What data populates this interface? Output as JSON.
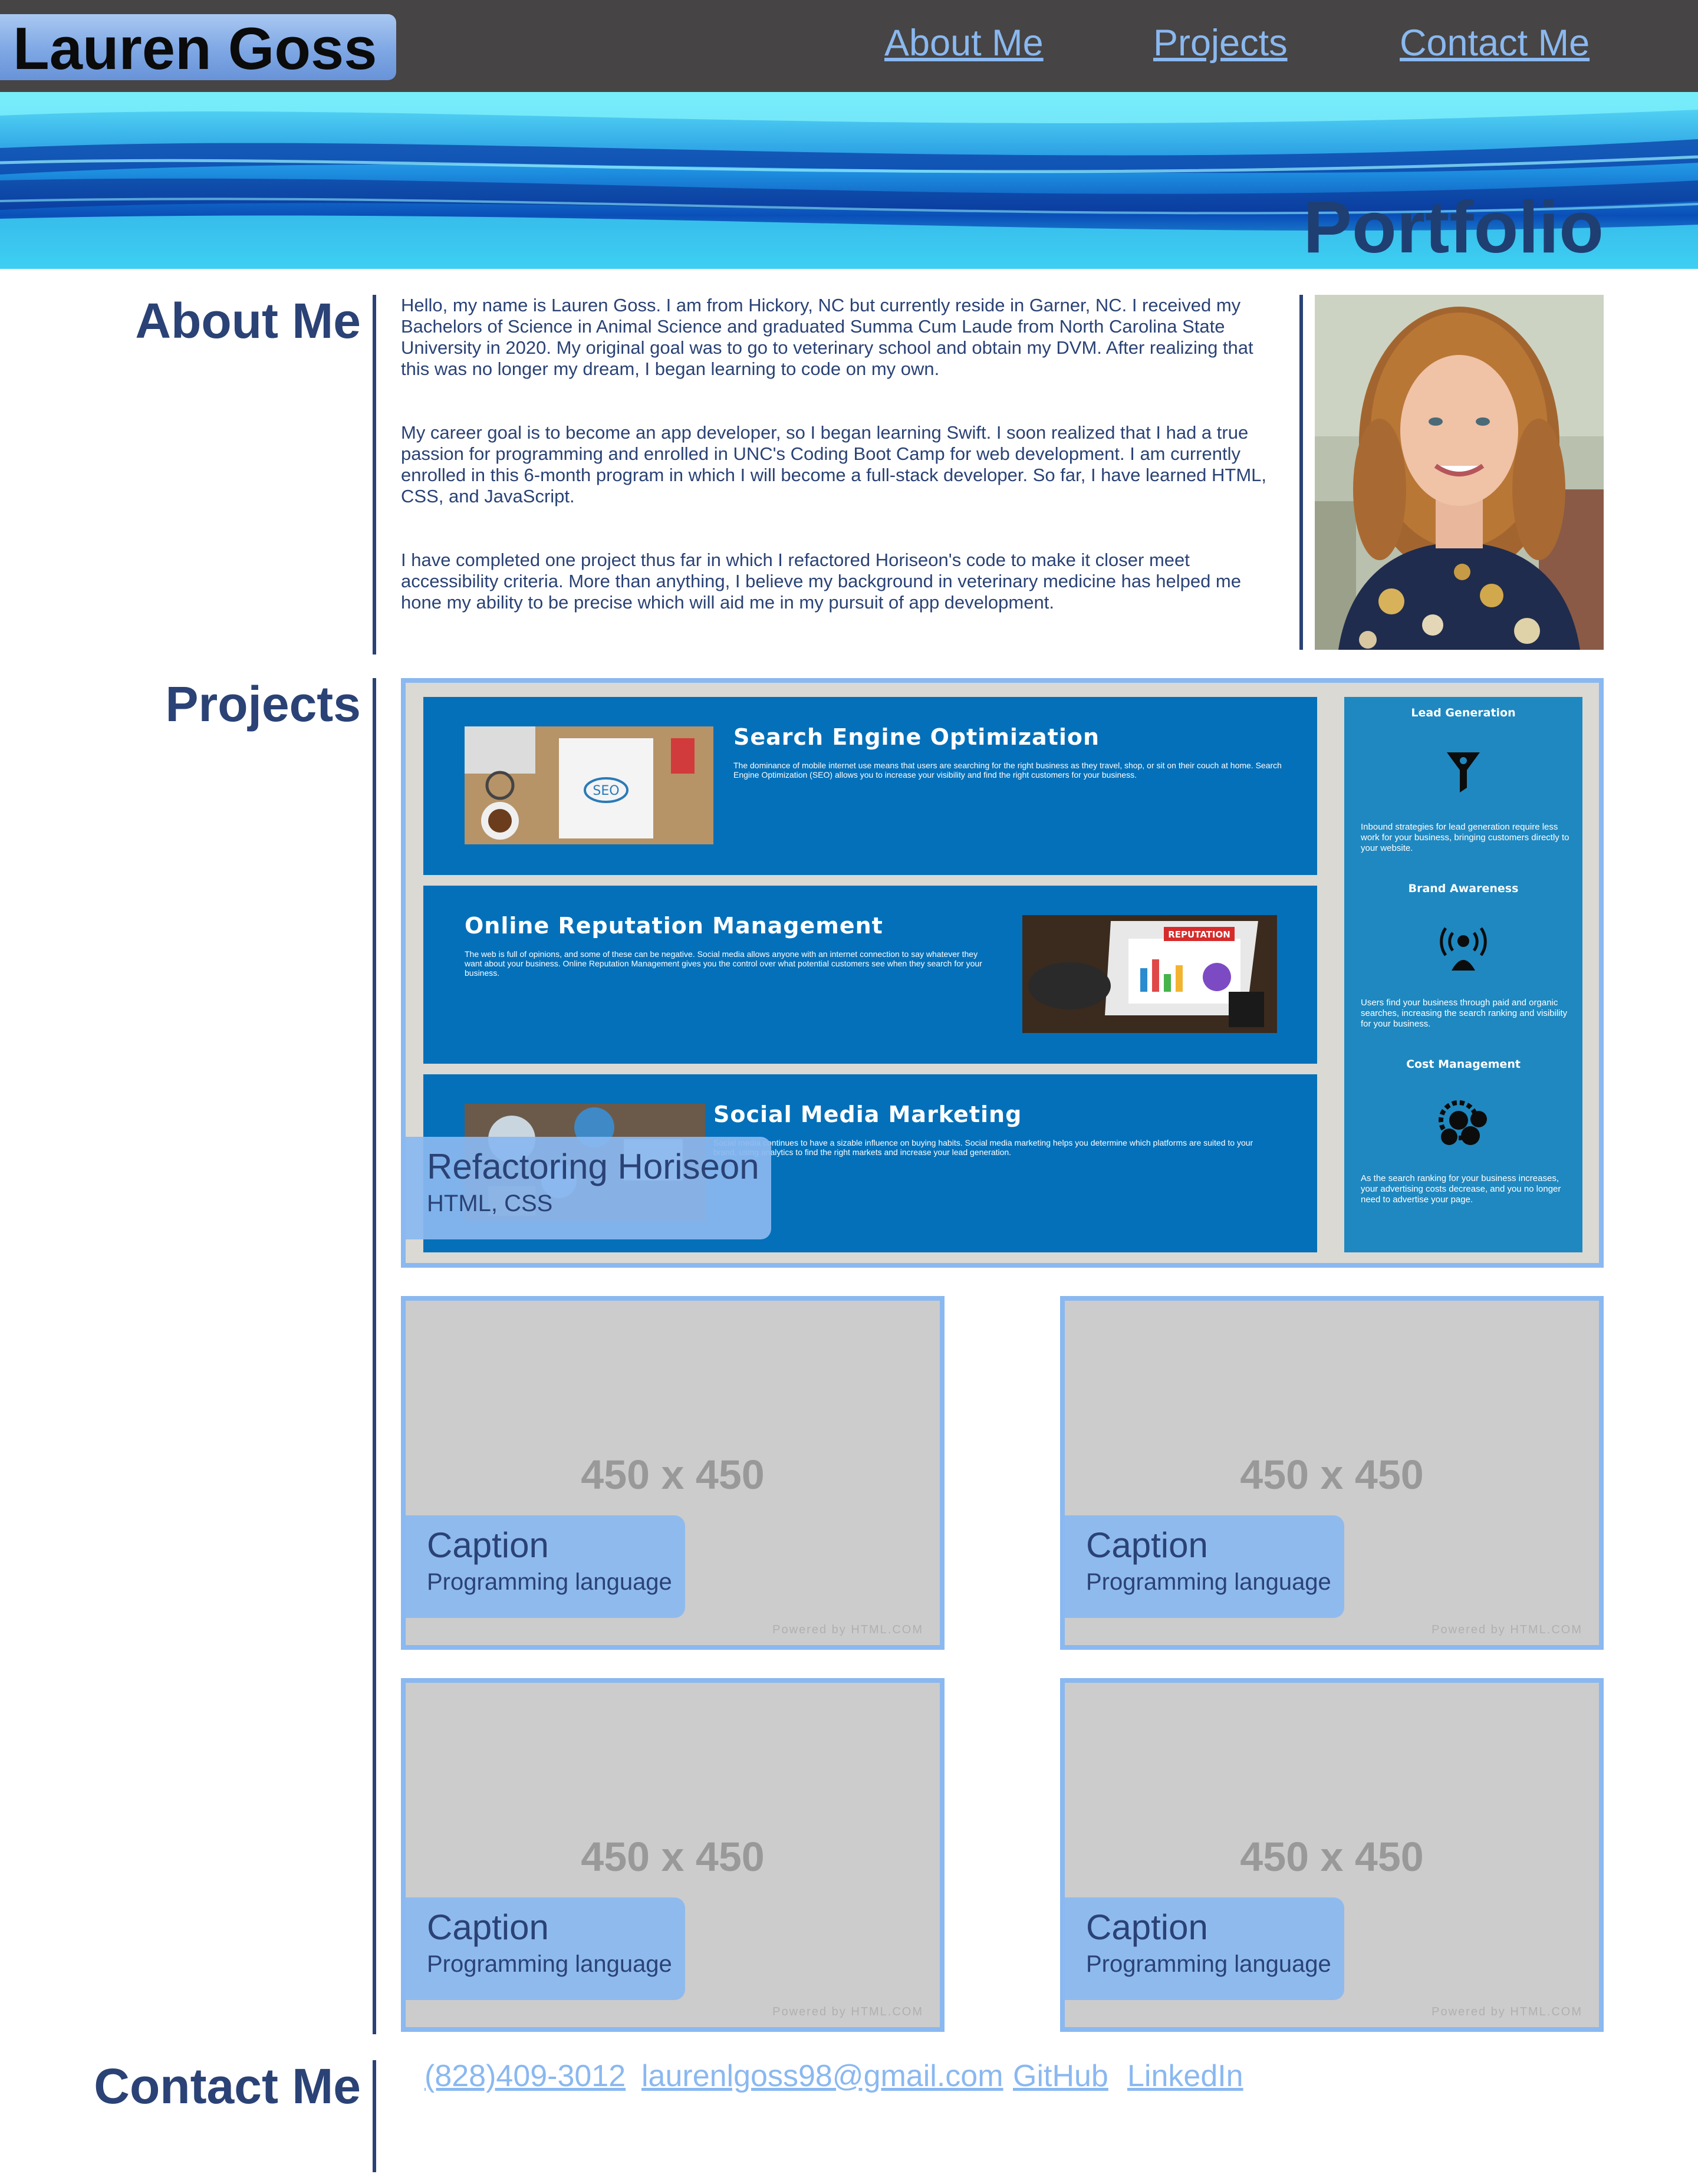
{
  "header": {
    "logo": "Lauren Goss",
    "nav": [
      "About Me",
      "Projects",
      "Contact Me"
    ]
  },
  "hero": {
    "title": "Portfolio"
  },
  "about": {
    "heading": "About Me",
    "paragraphs": [
      "Hello, my name is Lauren Goss. I am from Hickory, NC but currently reside in Garner, NC. I received my Bachelors of Science in Animal Science and graduated Summa Cum Laude from North Carolina State University in 2020. My original goal was to go to veterinary school and obtain my DVM. After realizing that this was no longer my dream, I began learning to code on my own.",
      "My career goal is to become an app developer, so I began learning Swift. I soon realized that I had a true passion for programming and enrolled in UNC's Coding Boot Camp for web development. I am currently enrolled in this 6-month program in which I will become a full-stack developer. So far, I have learned HTML, CSS, and JavaScript.",
      "I have completed one project thus far in which I refactored Horiseon's code to make it closer meet accessibility criteria. More than anything, I believe my background in veterinary medicine has helped me hone my ability to be precise which will aid me in my pursuit of app development."
    ]
  },
  "projects": {
    "heading": "Projects",
    "featured": {
      "caption_title": "Refactoring Horiseon",
      "caption_subtitle": "HTML, CSS",
      "screenshot": {
        "panels": [
          {
            "title": "Search Engine Optimization",
            "text": "The dominance of mobile internet use means that users are searching for the right business as they travel, shop, or sit on their couch at home. Search Engine Optimization (SEO) allows you to increase your visibility and find the right customers for your business.",
            "image_label": "SEO"
          },
          {
            "title": "Online Reputation Management",
            "text": "The web is full of opinions, and some of these can be negative. Social media allows anyone with an internet connection to say whatever they want about your business. Online Reputation Management gives you the control over what potential customers see when they search for your business.",
            "image_label": "REPUTATION"
          },
          {
            "title": "Social Media Marketing",
            "text": "Social media continues to have a sizable influence on buying habits. Social media marketing helps you determine which platforms are suited to your brand, using analytics to find the right markets and increase your lead generation."
          }
        ],
        "sidebar": [
          {
            "title": "Lead Generation",
            "text": "Inbound strategies for lead generation require less work for your business, bringing customers directly to your website.",
            "icon": "funnel-icon"
          },
          {
            "title": "Brand Awareness",
            "text": "Users find your business through paid and organic searches, increasing the search ranking and visibility for your business.",
            "icon": "broadcast-icon"
          },
          {
            "title": "Cost Management",
            "text": "As the search ranking for your business increases, your advertising costs decrease, and you no longer need to advertise your page.",
            "icon": "money-gear-icon"
          }
        ]
      }
    },
    "placeholders": [
      {
        "size": "450 x 450",
        "caption": "Caption",
        "language": "Programming language",
        "powered": "Powered by HTML.COM"
      },
      {
        "size": "450 x 450",
        "caption": "Caption",
        "language": "Programming language",
        "powered": "Powered by HTML.COM"
      },
      {
        "size": "450 x 450",
        "caption": "Caption",
        "language": "Programming language",
        "powered": "Powered by HTML.COM"
      },
      {
        "size": "450 x 450",
        "caption": "Caption",
        "language": "Programming language",
        "powered": "Powered by HTML.COM"
      }
    ]
  },
  "contact": {
    "heading": "Contact Me",
    "links": [
      "(828)409-3012",
      "laurenlgoss98@gmail.com",
      "GitHub",
      "LinkedIn"
    ]
  },
  "colors": {
    "header_bg": "#464444",
    "accent": "#8ab8f0",
    "heading": "#2a4275",
    "panel_blue": "#0470b9"
  }
}
